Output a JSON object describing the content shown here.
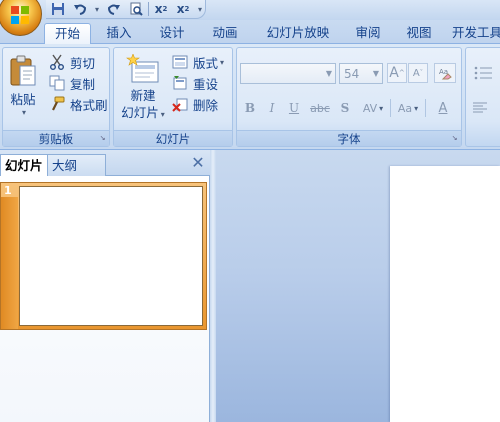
{
  "tabs": [
    {
      "label": "开始",
      "active": true
    },
    {
      "label": "插入"
    },
    {
      "label": "设计"
    },
    {
      "label": "动画"
    },
    {
      "label": "幻灯片放映"
    },
    {
      "label": "审阅"
    },
    {
      "label": "视图"
    },
    {
      "label": "开发工具"
    }
  ],
  "clipboard": {
    "paste": "粘贴",
    "cut": "剪切",
    "copy": "复制",
    "format_painter": "格式刷",
    "label": "剪贴板"
  },
  "slides": {
    "new_slide_line1": "新建",
    "new_slide_line2": "幻灯片",
    "layout": "版式",
    "reset": "重设",
    "delete": "删除",
    "label": "幻灯片"
  },
  "font": {
    "font_name": "",
    "font_size": "54",
    "label": "字体",
    "bold": "B",
    "italic": "I",
    "underline": "U",
    "strike": "abc",
    "shadow": "S",
    "spacing": "AV",
    "case": "Aa",
    "color": "A",
    "grow": "A",
    "shrink": "A"
  },
  "pane": {
    "tab_slides": "幻灯片",
    "tab_outline": "大纲",
    "close": "✕",
    "thumb_number": "1"
  },
  "quick_access": {
    "superscript": "x",
    "subscript": "x"
  },
  "colors": {
    "accent": "#15428b",
    "ribbon_bg": "#d0e1f5",
    "selection": "#e9962f"
  }
}
